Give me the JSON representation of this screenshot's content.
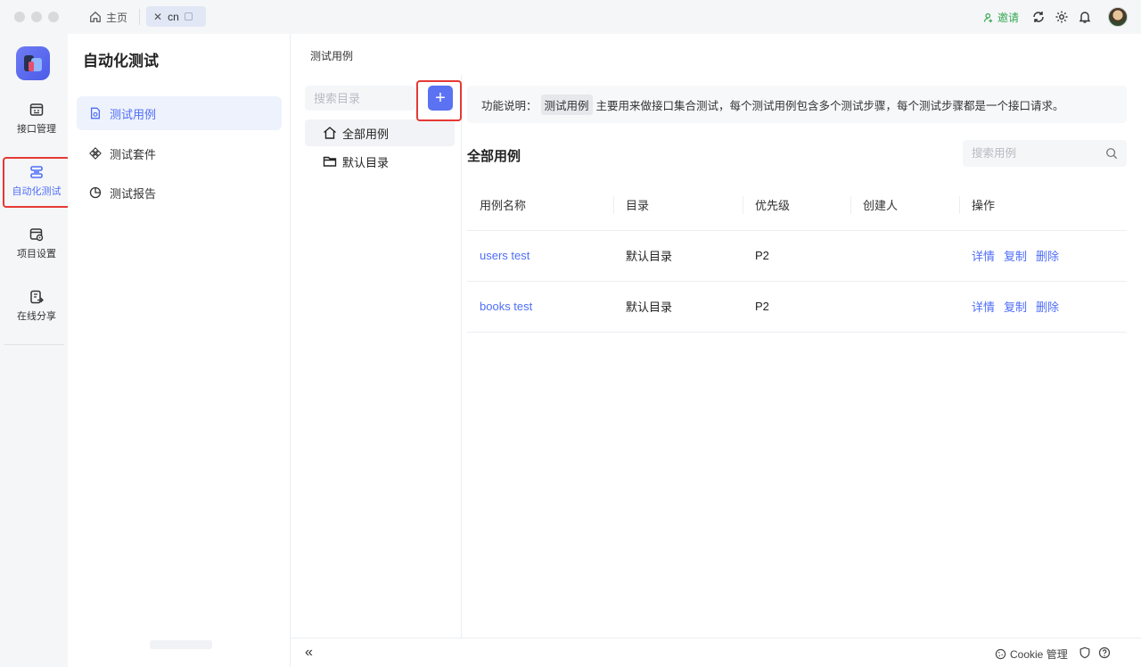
{
  "tabs": {
    "home": "主页",
    "project": "cn"
  },
  "topbar": {
    "invite": "邀请"
  },
  "nav": {
    "items": [
      {
        "label": "接口管理"
      },
      {
        "label": "自动化测试",
        "active": true
      },
      {
        "label": "项目设置"
      },
      {
        "label": "在线分享"
      }
    ]
  },
  "module": {
    "title": "自动化测试",
    "items": [
      {
        "label": "测试用例",
        "active": true
      },
      {
        "label": "测试套件"
      },
      {
        "label": "测试报告"
      }
    ]
  },
  "main": {
    "breadcrumb": "测试用例",
    "dir_search_placeholder": "搜索目录",
    "add_symbol": "+",
    "dirs": [
      {
        "label": "全部用例",
        "icon": "home-icon"
      },
      {
        "label": "默认目录",
        "icon": "folder-icon"
      }
    ],
    "description": {
      "prefix": "功能说明：",
      "tag": "测试用例",
      "text": "主要用来做接口集合测试，每个测试用例包含多个测试步骤，每个测试步骤都是一个接口请求。"
    },
    "list_title": "全部用例",
    "case_search_placeholder": "搜索用例",
    "table": {
      "headers": [
        "用例名称",
        "目录",
        "优先级",
        "创建人",
        "操作"
      ],
      "rows": [
        {
          "name": "users test",
          "dir": "默认目录",
          "priority": "P2",
          "creator": ""
        },
        {
          "name": "books test",
          "dir": "默认目录",
          "priority": "P2",
          "creator": ""
        }
      ],
      "actions": {
        "detail": "详情",
        "copy": "复制",
        "delete": "删除"
      }
    }
  },
  "bottom": {
    "collapse": "«",
    "cookie": "Cookie 管理"
  },
  "colors": {
    "accent": "#4f6ef7",
    "highlight_red": "#e53935",
    "invite_green": "#34a853"
  }
}
